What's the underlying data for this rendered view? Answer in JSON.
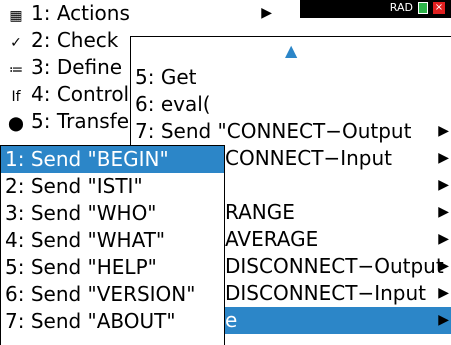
{
  "titlebar": {
    "mode": "RAD"
  },
  "menu1": {
    "items": [
      {
        "icon": "actions-icon",
        "label": "1: Actions"
      },
      {
        "icon": "check-icon",
        "label": "2: Check"
      },
      {
        "icon": "define-icon",
        "label": "3: Define"
      },
      {
        "icon": "control-icon",
        "label": "4: Control"
      },
      {
        "icon": "transfer-icon",
        "label": "5: Transfe"
      }
    ]
  },
  "menu2": {
    "items": [
      {
        "label": "5: Get"
      },
      {
        "label": "6: eval("
      },
      {
        "label": "7: Send \"CONNECT−Output"
      },
      {
        "label": "CONNECT−Input"
      },
      {
        "label": ""
      },
      {
        "label": "RANGE"
      },
      {
        "label": "AVERAGE"
      },
      {
        "label": "DISCONNECT−Output"
      },
      {
        "label": "DISCONNECT−Input"
      },
      {
        "label": "e"
      }
    ]
  },
  "menu3": {
    "items": [
      {
        "label": "1: Send \"BEGIN\""
      },
      {
        "label": "2: Send \"ISTI\""
      },
      {
        "label": "3: Send \"WHO\""
      },
      {
        "label": "4: Send \"WHAT\""
      },
      {
        "label": "5: Send \"HELP\""
      },
      {
        "label": "6: Send \"VERSION\""
      },
      {
        "label": "7: Send \"ABOUT\""
      }
    ]
  }
}
